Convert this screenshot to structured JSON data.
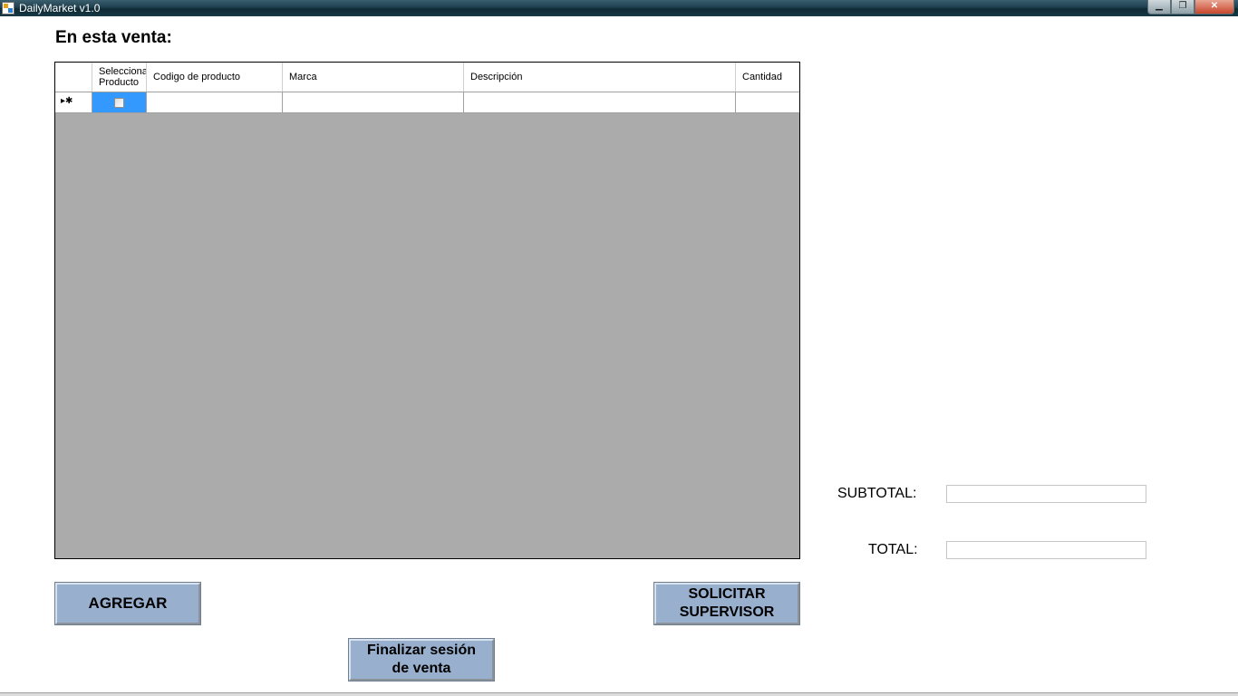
{
  "window": {
    "title": "DailyMarket v1.0",
    "controls": {
      "minimize": "▁",
      "maximize": "❐",
      "close": "✕"
    }
  },
  "heading": "En esta venta:",
  "grid": {
    "columns": [
      "Selecciona Producto",
      "Codigo de producto",
      "Marca",
      "Descripción",
      "Cantidad"
    ],
    "new_row_glyph": "▸✱",
    "rows": [
      {
        "selected": false,
        "codigo": "",
        "marca": "",
        "descripcion": "",
        "cantidad": ""
      }
    ],
    "colors": {
      "background": "#ababab",
      "selection": "#3399ff"
    }
  },
  "buttons": {
    "agregar": "AGREGAR",
    "solicitar": "SOLICITAR\nSUPERVISOR",
    "finalizar": "Finalizar sesión\nde venta"
  },
  "totals": {
    "subtotal_label": "SUBTOTAL:",
    "subtotal_value": "",
    "total_label": "TOTAL:",
    "total_value": ""
  },
  "accent_color": "#98b0ce"
}
